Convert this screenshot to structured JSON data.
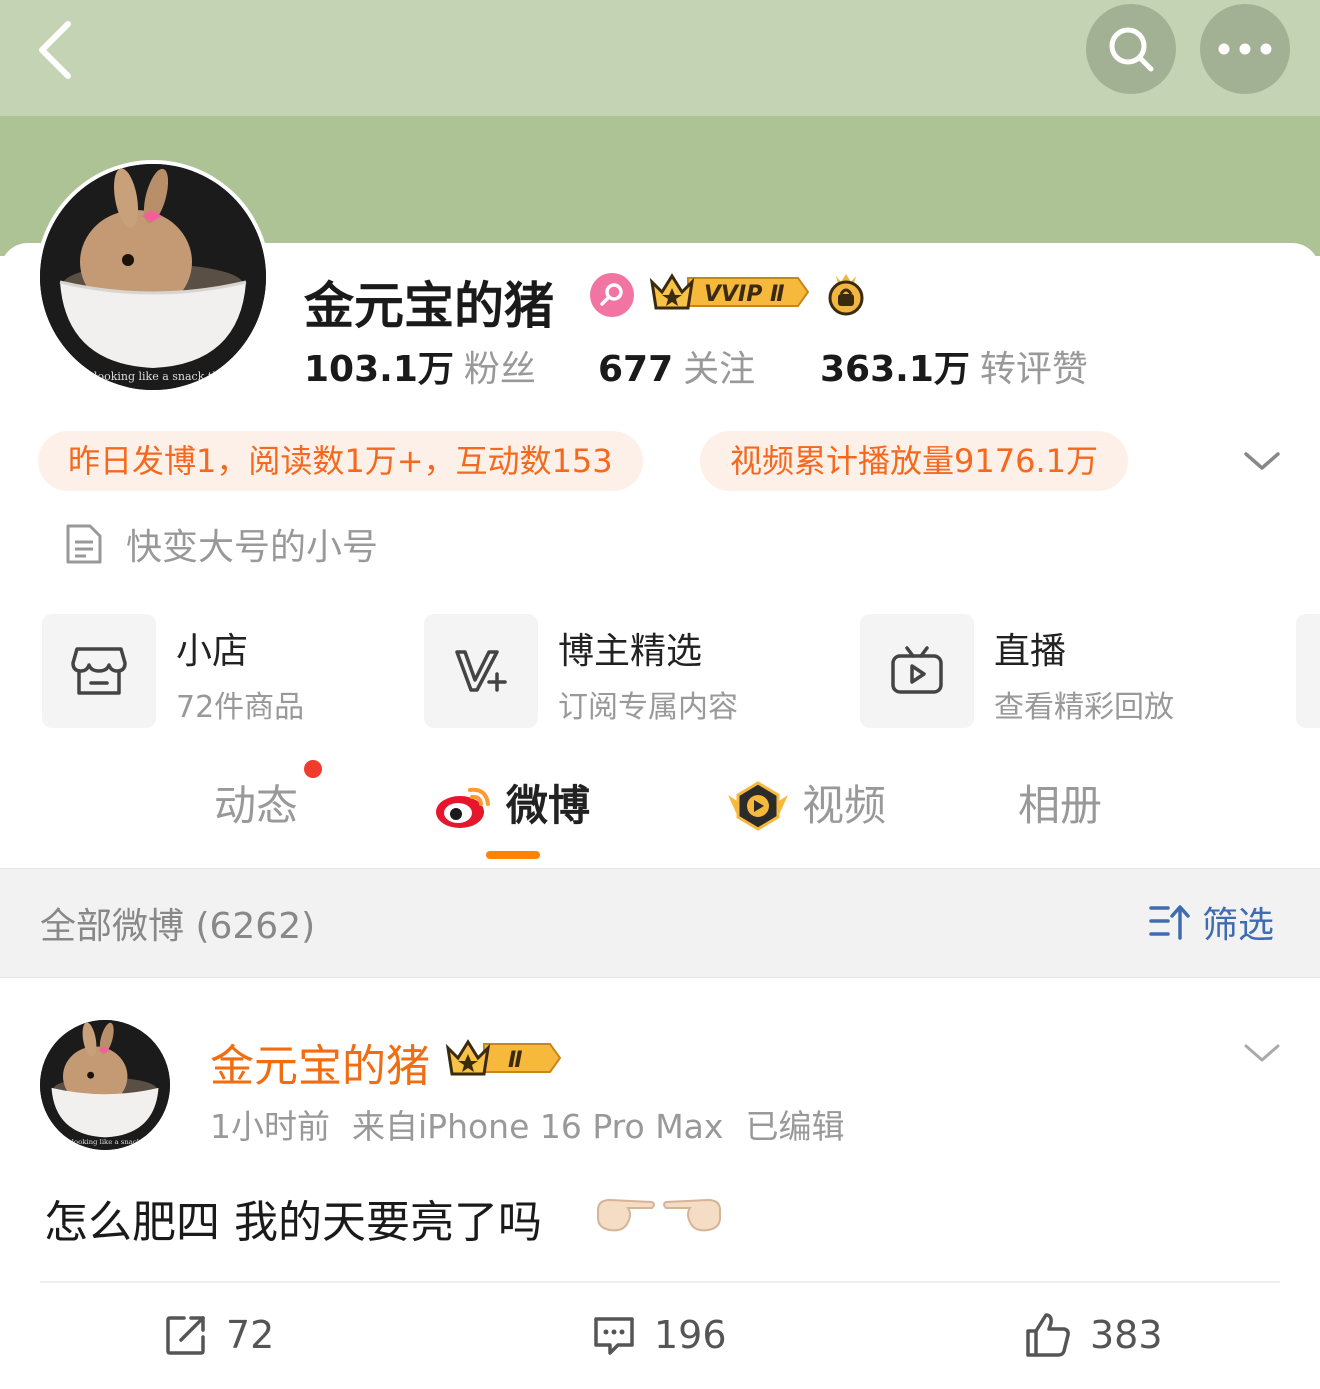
{
  "header": {
    "back_icon": "chevron-left-icon",
    "search_icon": "search-icon",
    "more_icon": "more-dots-icon",
    "bg_color": "#c3d3b3",
    "banner_color": "#adc295"
  },
  "profile": {
    "name": "金元宝的猪",
    "avatar_caption": "m looking like a snack this",
    "badges": {
      "gender": "female-icon",
      "vip": "VVIP Ⅱ",
      "crown": "crown-bag-icon"
    },
    "stats": [
      {
        "num": "103.1万",
        "label": "粉丝"
      },
      {
        "num": "677",
        "label": "关注"
      },
      {
        "num": "363.1万",
        "label": "转评赞"
      }
    ],
    "pills": [
      "昨日发博1，阅读数1万+，互动数153",
      "视频累计播放量9176.1万"
    ],
    "bio": "快变大号的小号"
  },
  "features": [
    {
      "title": "小店",
      "sub": "72件商品",
      "icon": "shop-icon"
    },
    {
      "title": "博主精选",
      "sub": "订阅专属内容",
      "icon": "v-plus-icon"
    },
    {
      "title": "直播",
      "sub": "查看精彩回放",
      "icon": "tv-play-icon"
    }
  ],
  "tabs": [
    {
      "label": "动态",
      "has_dot": true
    },
    {
      "label": "微博",
      "active": true,
      "icon": "weibo-logo-icon"
    },
    {
      "label": "视频",
      "icon": "video-play-icon"
    },
    {
      "label": "相册"
    }
  ],
  "filter": {
    "title": "全部微博 (6262)",
    "button": "筛选"
  },
  "post": {
    "author": "金元宝的猪",
    "badge": "Ⅱ",
    "avatar_caption": "m looking like a snack this",
    "time": "1小时前",
    "source": "来自iPhone 16 Pro Max",
    "edited": "已编辑",
    "text": "怎么肥四 我的天要亮了吗",
    "emojis": [
      "pointing-right-icon",
      "pointing-left-icon"
    ],
    "actions": {
      "reposts": "72",
      "comments": "196",
      "likes": "383"
    }
  },
  "colors": {
    "accent_orange": "#ff8200",
    "pill_text": "#f5691e",
    "pill_bg": "#fdf0e9",
    "author_orange": "#f26d11",
    "filter_blue": "#3f6cb0",
    "notif_red": "#f03b2d"
  }
}
